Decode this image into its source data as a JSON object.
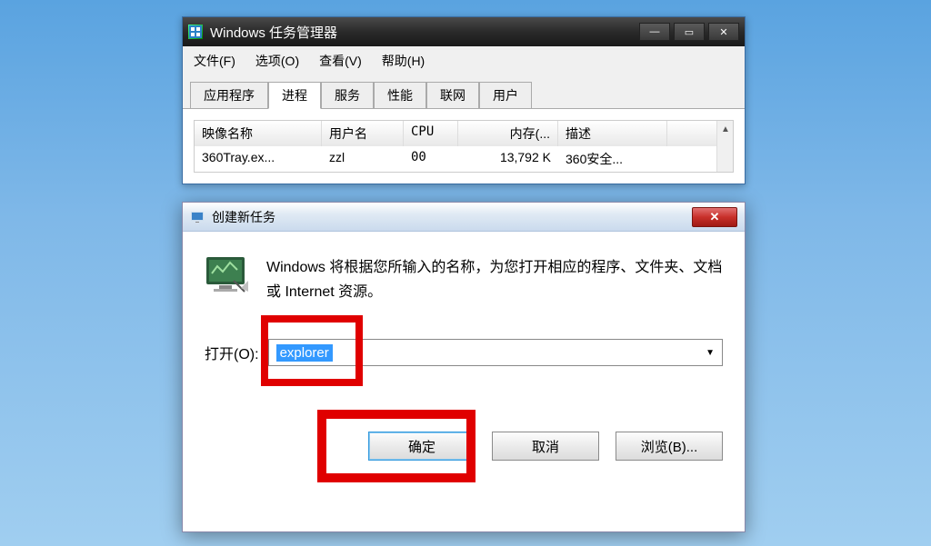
{
  "taskmgr": {
    "title": "Windows 任务管理器",
    "menu": [
      "文件(F)",
      "选项(O)",
      "查看(V)",
      "帮助(H)"
    ],
    "tabs": [
      "应用程序",
      "进程",
      "服务",
      "性能",
      "联网",
      "用户"
    ],
    "activeTabIndex": 1,
    "columns": [
      "映像名称",
      "用户名",
      "CPU",
      "内存(...",
      "描述"
    ],
    "rows": [
      {
        "image": "360Tray.ex...",
        "user": "zzl",
        "cpu": "00",
        "mem": "13,792 K",
        "desc": "360安全..."
      }
    ]
  },
  "rundlg": {
    "title": "创建新任务",
    "body_text": "Windows 将根据您所输入的名称，为您打开相应的程序、文件夹、文档或 Internet 资源。",
    "open_label": "打开(O):",
    "input_value": "explorer",
    "buttons": {
      "ok": "确定",
      "cancel": "取消",
      "browse": "浏览(B)..."
    }
  }
}
